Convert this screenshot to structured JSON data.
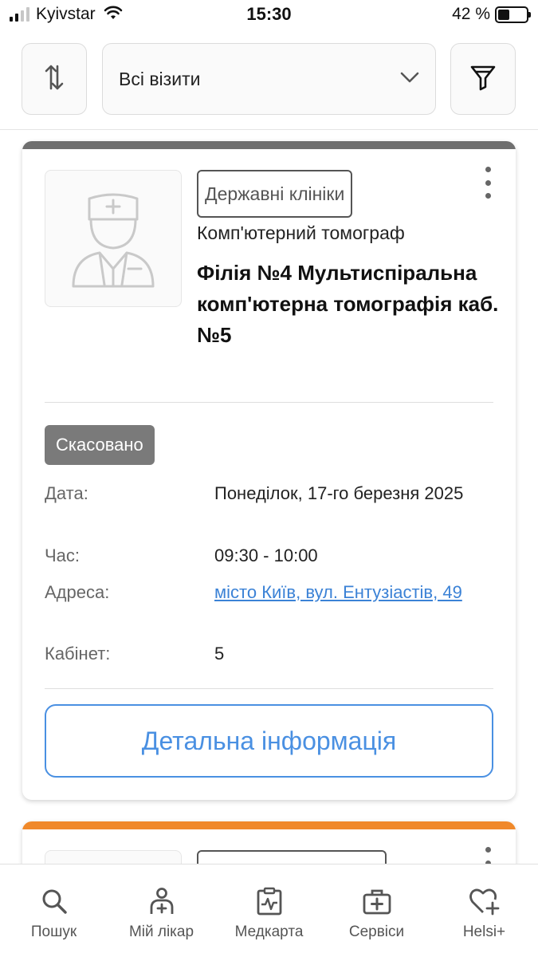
{
  "status_bar": {
    "carrier": "Kyivstar",
    "time": "15:30",
    "battery": "42 %",
    "battery_level": 0.42
  },
  "toolbar": {
    "sort_icon": "sort-arrows-icon",
    "filter_value": "Всі візити",
    "filter_icon": "funnel-icon"
  },
  "cards": [
    {
      "accent_color": "#6f6f6f",
      "tag": "Державні клініки",
      "service": "Комп'ютерний томограф",
      "clinic_name": "Філія №4 Мультиспіральна комп'ютерна томографія каб.№5",
      "status": "Скасовано",
      "fields": [
        {
          "label": "Дата:",
          "value": "Понеділок, 17-го березня 2025"
        },
        {
          "label": "Час:",
          "value": "09:30 - 10:00"
        },
        {
          "label": "Адреса:",
          "value": "місто Київ, вул. Ентузіастів, 49"
        },
        {
          "label": "Кабінет:",
          "value": "5"
        }
      ],
      "details_button": "Детальна інформація"
    },
    {
      "accent_color": "#f0892a"
    }
  ],
  "bottom_nav": [
    {
      "label": "Пошук",
      "icon": "search-icon"
    },
    {
      "label": "Мій лікар",
      "icon": "doctor-icon"
    },
    {
      "label": "Медкарта",
      "icon": "medical-card-icon"
    },
    {
      "label": "Сервіси",
      "icon": "services-case-icon"
    },
    {
      "label": "Helsi+",
      "icon": "heart-plus-icon"
    }
  ],
  "colors": {
    "link": "#3b82d6",
    "primary": "#4a90e2",
    "badge_cancelled": "#7a7a7a"
  }
}
